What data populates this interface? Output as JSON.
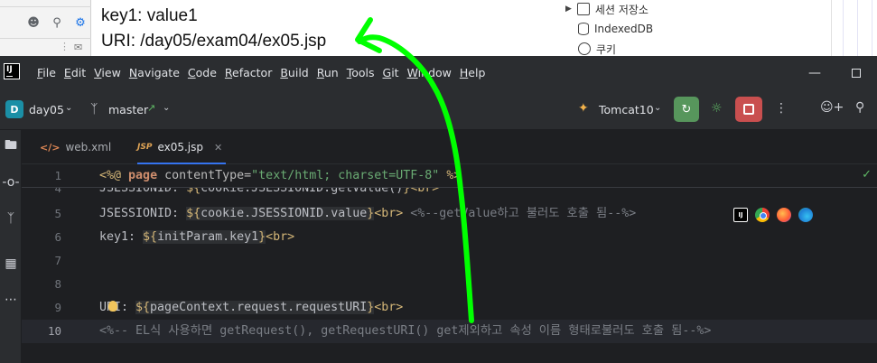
{
  "browser": {
    "output_lines": [
      "key1: value1",
      "URI: /day05/exam04/ex05.jsp"
    ],
    "devtools_tree": [
      {
        "label": "세션 저장소",
        "icon": "table-icon",
        "expandable": true
      },
      {
        "label": "IndexedDB",
        "icon": "database-icon",
        "expandable": false
      },
      {
        "label": "쿠키",
        "icon": "cookie-icon",
        "expandable": false
      }
    ]
  },
  "ide": {
    "menu": [
      "File",
      "Edit",
      "View",
      "Navigate",
      "Code",
      "Refactor",
      "Build",
      "Run",
      "Tools",
      "Git",
      "Window",
      "Help"
    ],
    "project_badge": "D",
    "project": "day05",
    "branch": "master",
    "run_config": "Tomcat10",
    "tabs": [
      {
        "label": "web.xml",
        "icon": "xml-icon",
        "active": false
      },
      {
        "label": "ex05.jsp",
        "icon": "jsp-icon",
        "active": true
      }
    ],
    "gutter_numbers": [
      "1",
      "4",
      "5",
      "6",
      "7",
      "8",
      "9",
      "10"
    ],
    "sticky_line": {
      "number": "1",
      "text": "<%@ page contentType=\"text/html; charset=UTF-8\" %>"
    },
    "code_lines": [
      {
        "number": "4",
        "text": "JSESSIONID: ${cookie.JSESSIONID.getValue()}<br>"
      },
      {
        "number": "5",
        "text": "JSESSIONID: ${cookie.JSESSIONID.value}<br> <%--getValue하고 불러도 호출 됨--%>"
      },
      {
        "number": "6",
        "text": "key1: ${initParam.key1}<br>"
      },
      {
        "number": "7",
        "text": ""
      },
      {
        "number": "8",
        "text": ""
      },
      {
        "number": "9",
        "text": "URI: ${pageContext.request.requestURI}<br>"
      },
      {
        "number": "10",
        "text": "<%-- EL식 사용하면 getRequest(), getRequestURI() get제외하고 속성 이름 형태로불러도 호출 됨--%>"
      }
    ],
    "colors": {
      "annotation": "#00ff00",
      "run": "#57965c",
      "stop": "#c94f4f",
      "accent": "#3574f0"
    }
  }
}
